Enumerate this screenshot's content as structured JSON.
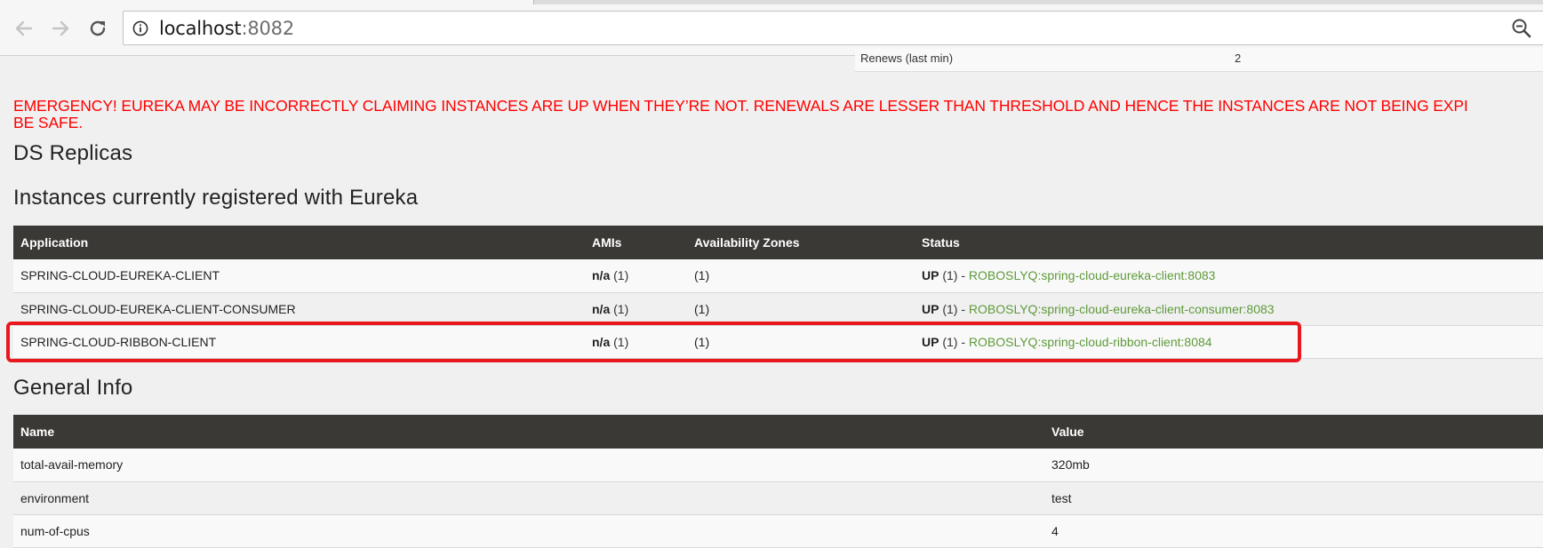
{
  "browser": {
    "url_host": "localhost",
    "url_port": ":8082",
    "icons": [
      "back-arrow-icon",
      "forward-arrow-icon",
      "reload-icon",
      "info-icon",
      "zoom-out-icon"
    ]
  },
  "stats": {
    "label": "Renews (last min)",
    "value": "2"
  },
  "emergency": {
    "line1": "EMERGENCY! EUREKA MAY BE INCORRECTLY CLAIMING INSTANCES ARE UP WHEN THEY’RE NOT. RENEWALS ARE LESSER THAN THRESHOLD AND HENCE THE INSTANCES ARE NOT BEING EXPI",
    "line2": "BE SAFE.",
    "color": "#ff0000"
  },
  "ds_replicas": {
    "title": "DS Replicas"
  },
  "instances": {
    "title": "Instances currently registered with Eureka",
    "headers": {
      "application": "Application",
      "amis": "AMIs",
      "zones": "Availability Zones",
      "status": "Status"
    },
    "rows": [
      {
        "application": "SPRING-CLOUD-EUREKA-CLIENT",
        "amis": "n/a",
        "amis_count": " (1)",
        "zones": "(1)",
        "status": "UP",
        "status_count": " (1) - ",
        "link": "ROBOSLYQ:spring-cloud-eureka-client:8083"
      },
      {
        "application": "SPRING-CLOUD-EUREKA-CLIENT-CONSUMER",
        "amis": "n/a",
        "amis_count": " (1)",
        "zones": "(1)",
        "status": "UP",
        "status_count": " (1) - ",
        "link": "ROBOSLYQ:spring-cloud-eureka-client-consumer:8083"
      },
      {
        "application": "SPRING-CLOUD-RIBBON-CLIENT",
        "amis": "n/a",
        "amis_count": " (1)",
        "zones": "(1)",
        "status": "UP",
        "status_count": " (1) - ",
        "link": "ROBOSLYQ:spring-cloud-ribbon-client:8084"
      }
    ],
    "link_color": "#5e9a3a"
  },
  "general_info": {
    "title": "General Info",
    "headers": {
      "name": "Name",
      "value": "Value"
    },
    "rows": [
      {
        "name": "total-avail-memory",
        "value": "320mb"
      },
      {
        "name": "environment",
        "value": "test"
      },
      {
        "name": "num-of-cpus",
        "value": "4"
      }
    ]
  },
  "annotation": {
    "highlight_color": "#e8181e"
  }
}
